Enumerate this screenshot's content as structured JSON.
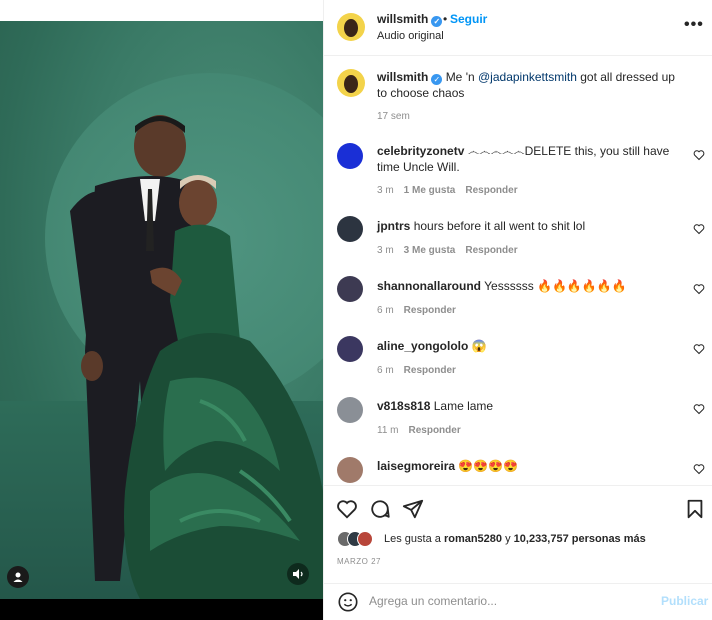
{
  "post": {
    "username": "willsmith",
    "follow_label": "Seguir",
    "audio_label": "Audio original",
    "dot": "•",
    "more": "•••",
    "caption_text": "Me 'n ",
    "caption_mention": "@jadapinkettsmith",
    "caption_rest": " got all dressed up to choose chaos",
    "caption_time": "17 sem"
  },
  "comments": [
    {
      "user": "celebrityzonetv",
      "text": "෴෴෴෴෴DELETE this, you still have time Uncle Will.",
      "time": "3 m",
      "likes": "1 Me gusta",
      "reply": "Responder",
      "avatar_color": "#1a2fd6"
    },
    {
      "user": "jpntrs",
      "text": "hours before it all went to shit lol",
      "time": "3 m",
      "likes": "3 Me gusta",
      "reply": "Responder",
      "avatar_color": "#2c3440"
    },
    {
      "user": "shannonallaround",
      "text": "Yessssss 🔥🔥🔥🔥🔥🔥",
      "time": "6 m",
      "likes": "",
      "reply": "Responder",
      "avatar_color": "#3d3a52"
    },
    {
      "user": "aline_yongololo",
      "text": "😱",
      "time": "6 m",
      "likes": "",
      "reply": "Responder",
      "avatar_color": "#3b3760"
    },
    {
      "user": "v818s818",
      "text": "Lame lame",
      "time": "11 m",
      "likes": "",
      "reply": "Responder",
      "avatar_color": "#8a8f96"
    },
    {
      "user": "laisegmoreira",
      "text": "😍😍😍😍",
      "time": "",
      "likes": "",
      "reply": "",
      "avatar_color": "#a07a6a"
    }
  ],
  "likes": {
    "prefix": "Les gusta a ",
    "user": "roman5280",
    "middle": " y ",
    "count": "10,233,757 personas más"
  },
  "date": "MARZO 27",
  "add_comment": {
    "placeholder": "Agrega un comentario...",
    "publish": "Publicar"
  },
  "colors": {
    "accent": "#0095f6",
    "verified": "#3897f0",
    "meta": "#8e8e8e"
  }
}
